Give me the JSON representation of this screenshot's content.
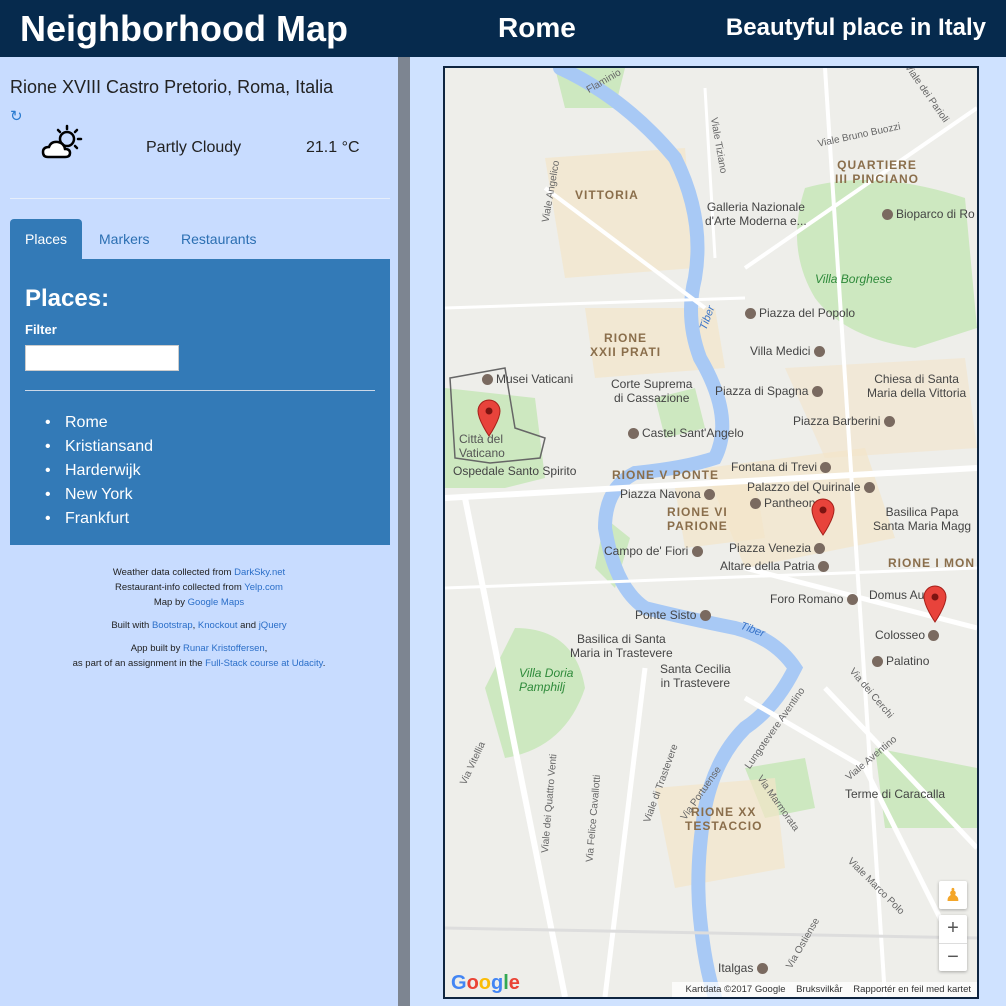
{
  "header": {
    "app_title": "Neighborhood Map",
    "city": "Rome",
    "tagline": "Beautyful place in Italy"
  },
  "sidebar": {
    "location": "Rione XVIII Castro Pretorio, Roma, Italia",
    "weather": {
      "icon": "partly-cloudy-icon",
      "summary": "Partly Cloudy",
      "temperature": "21.1 °C"
    },
    "tabs": [
      {
        "label": "Places",
        "active": true
      },
      {
        "label": "Markers",
        "active": false
      },
      {
        "label": "Restaurants",
        "active": false
      }
    ],
    "panel": {
      "heading": "Places:",
      "filter_label": "Filter",
      "filter_value": "",
      "places": [
        "Rome",
        "Kristiansand",
        "Harderwijk",
        "New York",
        "Frankfurt"
      ]
    },
    "credits": {
      "weather_prefix": "Weather data collected from ",
      "weather_link": "DarkSky.net",
      "restaurant_prefix": "Restaurant-info collected from ",
      "restaurant_link": "Yelp.com",
      "map_prefix": "Map by ",
      "map_link": "Google Maps",
      "built_prefix": "Built with ",
      "built_link1": "Bootstrap",
      "built_sep1": ", ",
      "built_link2": "Knockout",
      "built_sep2": " and ",
      "built_link3": "jQuery",
      "author_prefix": "App built by ",
      "author_link": "Runar Kristoffersen",
      "author_suffix": ",",
      "course_prefix": "as part of an assignment in the ",
      "course_link": "Full-Stack course at Udacity",
      "course_suffix": "."
    }
  },
  "map": {
    "labels": {
      "vittoria": "VITTORIA",
      "prati": "RIONE\nXXII PRATI",
      "quartiere": "QUARTIERE\nIII PINCIANO",
      "ponte": "RIONE V PONTE",
      "parione": "RIONE VI\nPARIONE",
      "monti": "RIONE I MON",
      "testaccio": "RIONE XX\nTESTACCIO",
      "vaticano": "Città del\nVaticano",
      "villa_borghese": "Villa Borghese",
      "villa_doria": "Villa Doria\nPamphilj",
      "tiber1": "Tiber",
      "tiber2": "Tiber",
      "musei": "Musei Vaticani",
      "corte": "Corte Suprema\ndi Cassazione",
      "castel": "Castel Sant'Angelo",
      "piazza_popolo": "Piazza del Popolo",
      "villa_medici": "Villa Medici",
      "piazza_spagna": "Piazza di Spagna",
      "barberini": "Piazza Barberini",
      "trevi": "Fontana di Trevi",
      "quirinale": "Palazzo del Quirinale",
      "navona": "Piazza Navona",
      "pantheon": "Pantheon",
      "campo": "Campo de' Fiori",
      "venezia": "Piazza Venezia",
      "altare": "Altare della Patria",
      "foro": "Foro Romano",
      "domus": "Domus Au",
      "colosseo": "Colosseo",
      "palatino": "Palatino",
      "ponte_sisto": "Ponte Sisto",
      "santa_maria": "Basilica di Santa\nMaria in Trastevere",
      "cecilia": "Santa Cecilia\nin Trastevere",
      "caracalla": "Terme di Caracalla",
      "ospedale": "Ospedale Santo Spirito",
      "galleria": "Galleria Nazionale\nd'Arte Moderna e...",
      "bioparco": "Bioparco di Ro",
      "chiesa": "Chiesa di Santa\nMaria della Vittoria",
      "basilica_papale": "Basilica Papa\nSanta Maria Magg",
      "italgas": "Italgas",
      "flaminio": "Flaminio",
      "viale_tiziano": "Viale Tiziano",
      "viale_angelico": "Viale Angelico",
      "viale_bruno": "Viale Bruno Buozzi",
      "viale_parioli": "Viale dei Parioli",
      "lungotevere": "Lungotevere Aventino",
      "viale_trastevere": "Viale di Trastevere",
      "via_portuense": "Via Portuense",
      "viale_marmorata": "Via Marmorata",
      "via_ostiense": "Via Ostiense",
      "viale_marco_polo": "Viale Marco Polo",
      "via_cerchi": "Via dei Cerchi",
      "viale_aventino": "Viale Aventino",
      "via_vitellia": "Via Vitellia",
      "via_quattro_venti": "Viale dei Quattro Venti",
      "via_cavallotti": "Via Felice Cavallotti"
    },
    "google_logo": "Google",
    "attribution": {
      "data": "Kartdata ©2017 Google",
      "terms": "Bruksvilkår",
      "report": "Rapportér en feil med kartet"
    },
    "zoom_in": "+",
    "zoom_out": "−",
    "accent": "#e8433b"
  }
}
